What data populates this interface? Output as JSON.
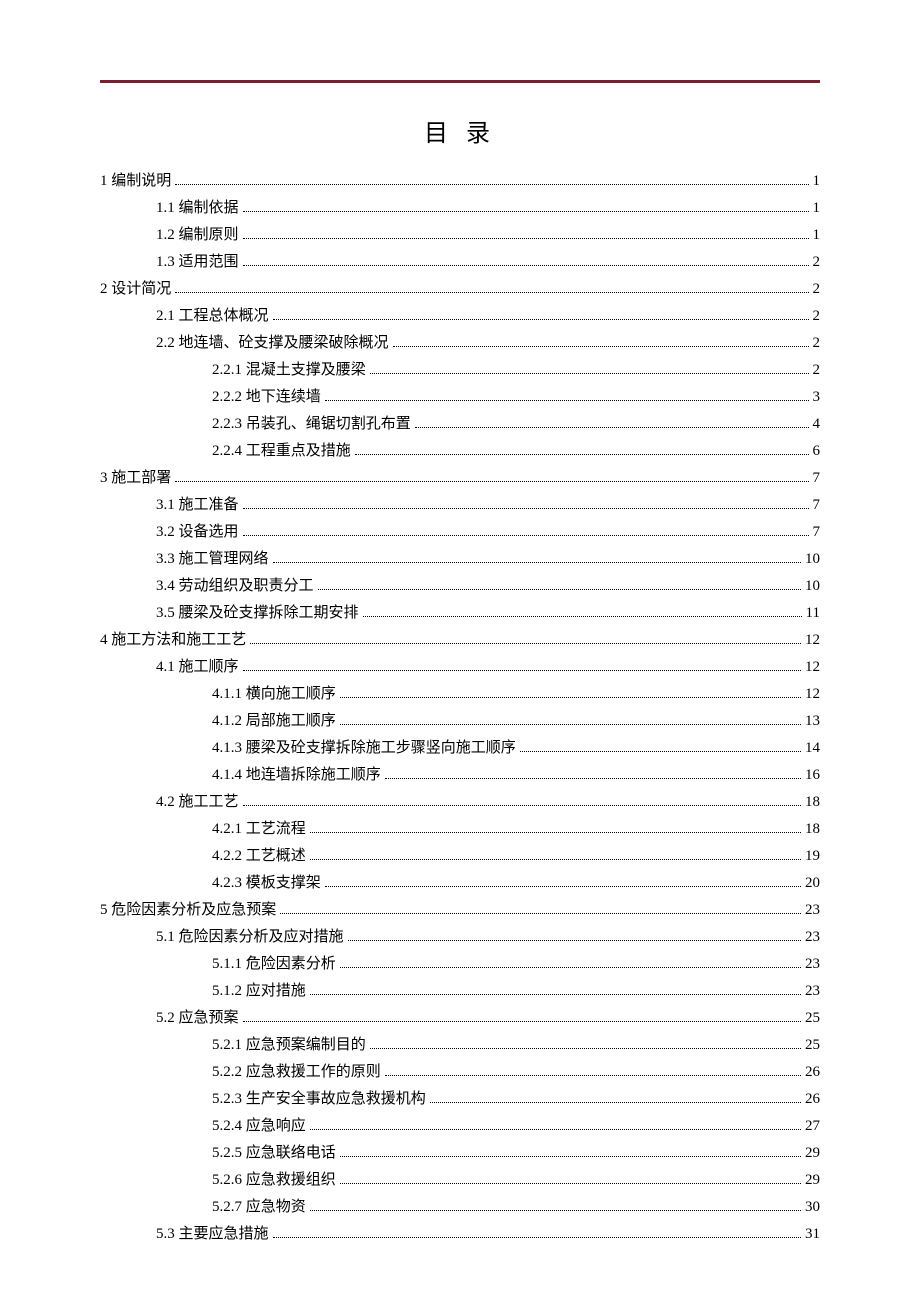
{
  "title": "目 录",
  "entries": [
    {
      "level": 1,
      "label": "1 编制说明",
      "page": "1"
    },
    {
      "level": 2,
      "label": "1.1 编制依据",
      "page": "1"
    },
    {
      "level": 2,
      "label": "1.2 编制原则",
      "page": "1"
    },
    {
      "level": 2,
      "label": "1.3 适用范围",
      "page": "2"
    },
    {
      "level": 1,
      "label": "2 设计简况",
      "page": "2"
    },
    {
      "level": 2,
      "label": "2.1 工程总体概况",
      "page": "2"
    },
    {
      "level": 2,
      "label": "2.2 地连墙、砼支撑及腰梁破除概况",
      "page": "2"
    },
    {
      "level": 3,
      "label": "2.2.1 混凝土支撑及腰梁",
      "page": "2"
    },
    {
      "level": 3,
      "label": "2.2.2 地下连续墙",
      "page": "3"
    },
    {
      "level": 3,
      "label": "2.2.3 吊装孔、绳锯切割孔布置",
      "page": "4"
    },
    {
      "level": 3,
      "label": "2.2.4 工程重点及措施",
      "page": "6"
    },
    {
      "level": 1,
      "label": "3 施工部署",
      "page": "7"
    },
    {
      "level": 2,
      "label": "3.1 施工准备",
      "page": "7"
    },
    {
      "level": 2,
      "label": "3.2 设备选用",
      "page": "7"
    },
    {
      "level": 2,
      "label": "3.3 施工管理网络",
      "page": "10"
    },
    {
      "level": 2,
      "label": "3.4 劳动组织及职责分工",
      "page": "10"
    },
    {
      "level": 2,
      "label": "3.5 腰梁及砼支撑拆除工期安排",
      "page": "11"
    },
    {
      "level": 1,
      "label": "4 施工方法和施工工艺",
      "page": "12"
    },
    {
      "level": 2,
      "label": "4.1 施工顺序",
      "page": "12"
    },
    {
      "level": 3,
      "label": "4.1.1 横向施工顺序",
      "page": "12"
    },
    {
      "level": 3,
      "label": "4.1.2 局部施工顺序",
      "page": "13"
    },
    {
      "level": 3,
      "label": "4.1.3 腰梁及砼支撑拆除施工步骤竖向施工顺序",
      "page": "14"
    },
    {
      "level": 3,
      "label": "4.1.4 地连墙拆除施工顺序",
      "page": "16"
    },
    {
      "level": 2,
      "label": "4.2 施工工艺",
      "page": "18"
    },
    {
      "level": 3,
      "label": "4.2.1 工艺流程",
      "page": "18"
    },
    {
      "level": 3,
      "label": "4.2.2 工艺概述",
      "page": "19"
    },
    {
      "level": 3,
      "label": "4.2.3 模板支撑架",
      "page": "20"
    },
    {
      "level": 1,
      "label": "5 危险因素分析及应急预案",
      "page": "23"
    },
    {
      "level": 2,
      "label": "5.1 危险因素分析及应对措施",
      "page": "23"
    },
    {
      "level": 3,
      "label": "5.1.1 危险因素分析",
      "page": "23"
    },
    {
      "level": 3,
      "label": "5.1.2 应对措施",
      "page": "23"
    },
    {
      "level": 2,
      "label": "5.2 应急预案",
      "page": "25"
    },
    {
      "level": 3,
      "label": "5.2.1 应急预案编制目的",
      "page": "25"
    },
    {
      "level": 3,
      "label": "5.2.2 应急救援工作的原则",
      "page": "26"
    },
    {
      "level": 3,
      "label": "5.2.3 生产安全事故应急救援机构",
      "page": "26"
    },
    {
      "level": 3,
      "label": "5.2.4 应急响应",
      "page": "27"
    },
    {
      "level": 3,
      "label": "5.2.5 应急联络电话",
      "page": "29"
    },
    {
      "level": 3,
      "label": "5.2.6 应急救援组织",
      "page": "29"
    },
    {
      "level": 3,
      "label": "5.2.7 应急物资",
      "page": "30"
    },
    {
      "level": 2,
      "label": "5.3 主要应急措施",
      "page": "31"
    }
  ]
}
